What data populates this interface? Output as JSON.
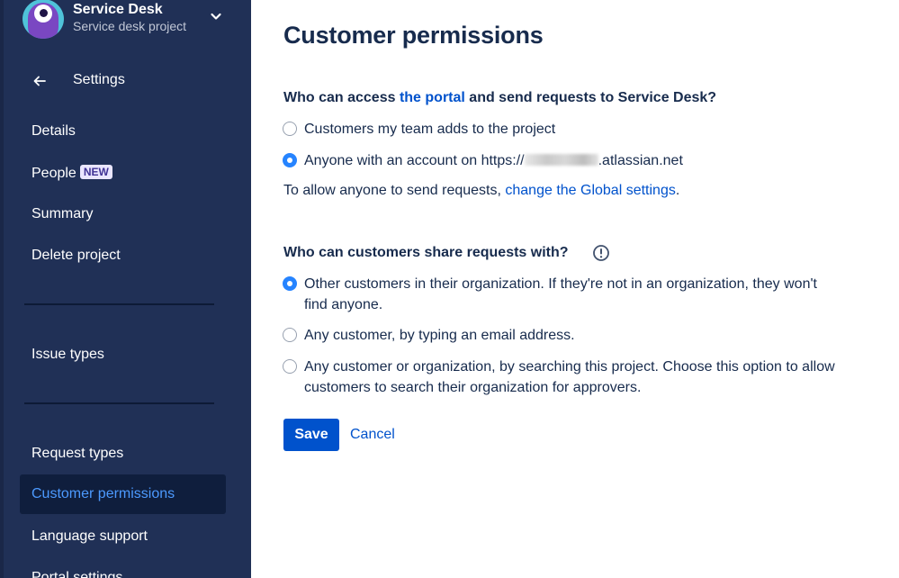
{
  "sidebar": {
    "project": {
      "name": "Service Desk",
      "type": "Service desk project",
      "avatar_icon": "monster-avatar-icon",
      "menu_icon": "chevron-down-icon"
    },
    "back": {
      "icon": "arrow-left-icon",
      "label": "Settings"
    },
    "items": [
      {
        "label": "Details"
      },
      {
        "label": "People",
        "badge": "NEW"
      },
      {
        "label": "Summary"
      },
      {
        "label": "Delete project"
      },
      {
        "label": "Issue types"
      },
      {
        "label": "Request types"
      },
      {
        "label": "Customer permissions",
        "active": true
      },
      {
        "label": "Language support"
      },
      {
        "label": "Portal settings"
      }
    ]
  },
  "main": {
    "title": "Customer permissions",
    "access": {
      "question_prefix": "Who can access ",
      "question_link": "the portal",
      "question_suffix": " and send requests to Service Desk?",
      "options": [
        {
          "label": "Customers my team adds to the project",
          "checked": false
        },
        {
          "label_prefix": "Anyone with an account on https://",
          "label_suffix": ".atlassian.net",
          "checked": true
        }
      ],
      "note_text": "To allow anyone to send requests, ",
      "note_link": "change the Global settings",
      "note_end": "."
    },
    "share": {
      "question": "Who can customers share requests with?",
      "info_icon": "info-icon",
      "options": [
        {
          "label": "Other customers in their organization. If they're not in an organization, they won't find anyone.",
          "checked": true
        },
        {
          "label": "Any customer, by typing an email address.",
          "checked": false
        },
        {
          "label": "Any customer or organization, by searching this project. Choose this option to allow customers to search their organization for approvers.",
          "checked": false
        }
      ]
    },
    "buttons": {
      "save": "Save",
      "cancel": "Cancel"
    }
  },
  "colors": {
    "sidebar_bg": "#203056",
    "sidebar_active_bg": "#0f1e3d",
    "active_text": "#4c9aff",
    "primary": "#0052cc",
    "radio_checked": "#2684ff",
    "text": "#172b4d"
  }
}
